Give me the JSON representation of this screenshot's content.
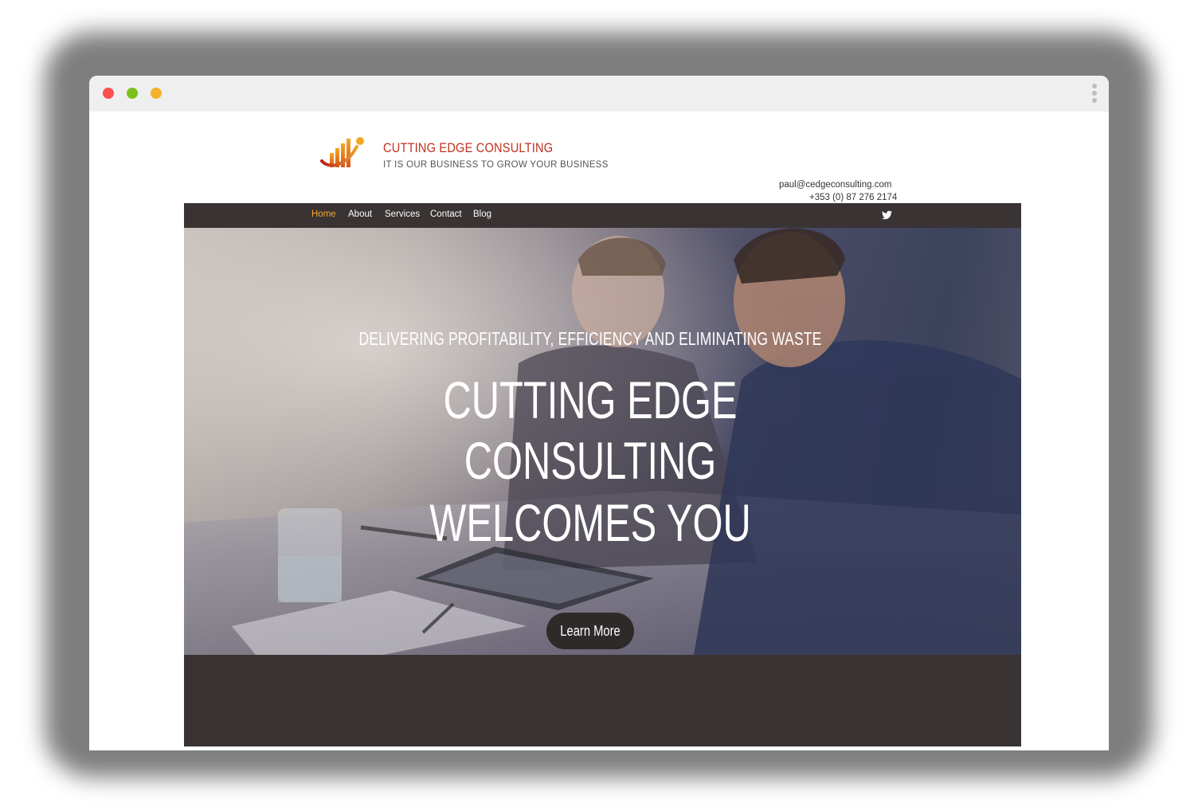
{
  "colors": {
    "window_dot_close": "#ff4f4f",
    "window_dot_minimize": "#7ac21b",
    "window_dot_zoom": "#f7b12a",
    "brand_red": "#c0301e",
    "nav_active": "#f0a830",
    "nav_background": "#3a3333",
    "button_background": "#2f2a2a"
  },
  "window": {
    "icons": [
      "close-dot",
      "minimize-dot",
      "zoom-dot",
      "kebab-menu-icon"
    ]
  },
  "header": {
    "logo_icon": "bar-chart-swoosh-logo",
    "brand_name": "CUTTING EDGE CONSULTING",
    "tagline": "IT IS OUR BUSINESS TO GROW YOUR BUSINESS",
    "email": "paul@cedgeconsulting.com",
    "phone": "+353 (0) 87 276 2174"
  },
  "nav": {
    "items": [
      {
        "label": "Home",
        "active": true
      },
      {
        "label": "About",
        "active": false
      },
      {
        "label": "Services",
        "active": false
      },
      {
        "label": "Contact",
        "active": false
      },
      {
        "label": "Blog",
        "active": false
      }
    ],
    "social_icon": "twitter-icon"
  },
  "hero": {
    "subtitle": "DELIVERING PROFITABILITY, EFFICIENCY AND ELIMINATING WASTE",
    "title_lines": [
      "CUTTING EDGE",
      "CONSULTING",
      "WELCOMES YOU"
    ],
    "button_label": "Learn More"
  }
}
